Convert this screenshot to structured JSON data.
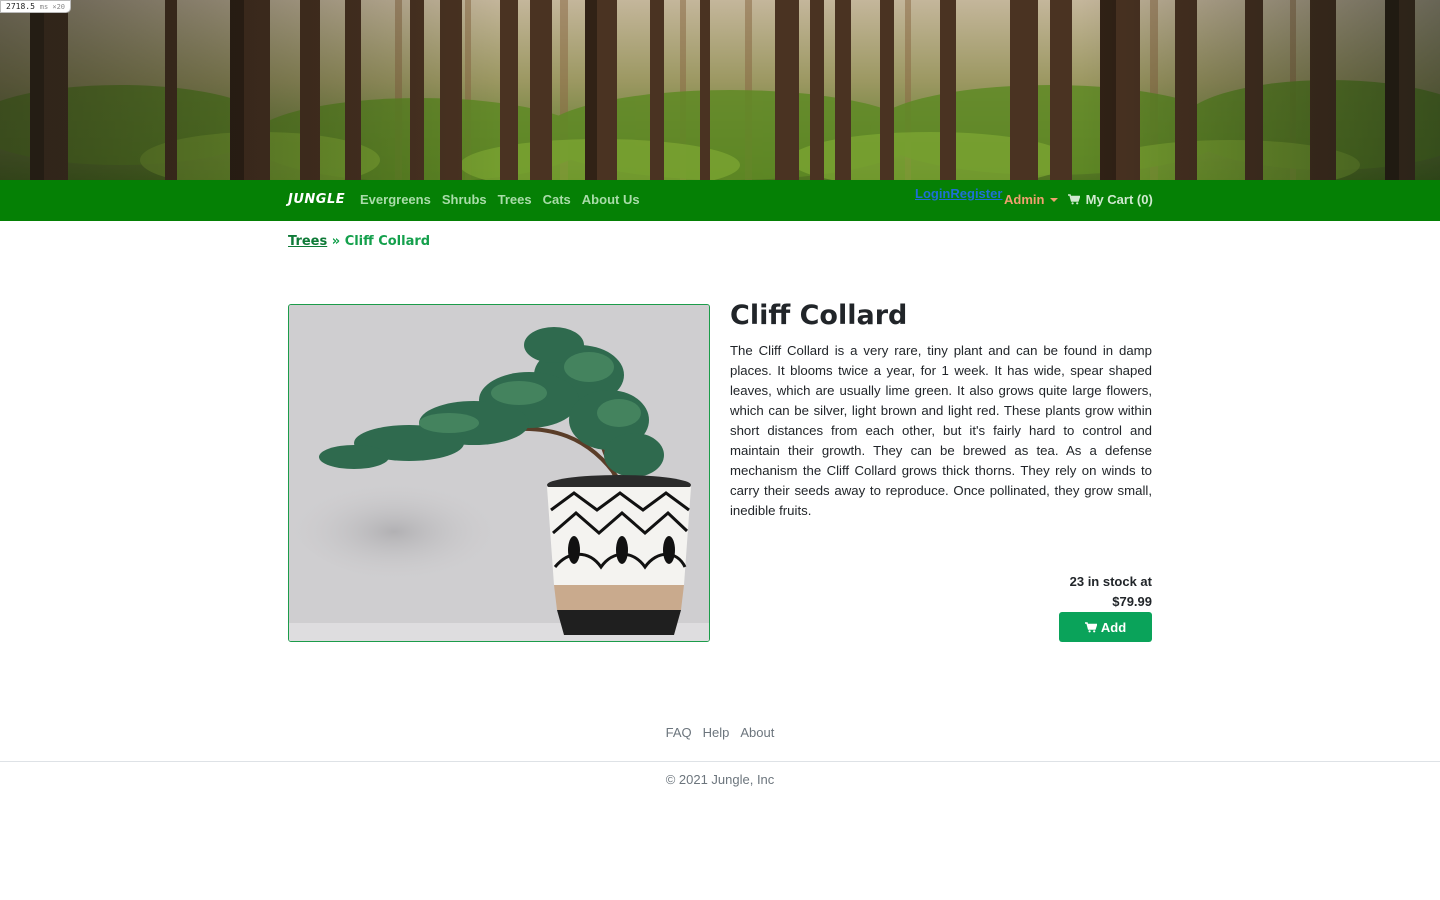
{
  "debug": {
    "readout": "2718.5",
    "suffix": "ms ×20"
  },
  "nav": {
    "brand": "JUNGLE",
    "links": [
      "Evergreens",
      "Shrubs",
      "Trees",
      "Cats",
      "About Us"
    ],
    "login": "Login",
    "register": "Register",
    "admin": "Admin",
    "cart": "My Cart (0)",
    "cart_icon": "cart-icon"
  },
  "breadcrumb": {
    "parent": "Trees",
    "separator": " » ",
    "current": "Cliff Collard"
  },
  "product": {
    "name": "Cliff Collard",
    "description": "The Cliff Collard is a very rare, tiny plant and can be found in damp places. It blooms twice a year, for 1 week. It has wide, spear shaped leaves, which are usually lime green. It also grows quite large flowers, which can be silver, light brown and light red. These plants grow within short distances from each other, but it's fairly hard to control and maintain their growth. They can be brewed as tea. As a defense mechanism the Cliff Collard grows thick thorns. They rely on winds to carry their seeds away to reproduce. Once pollinated, they grow small, inedible fruits.",
    "stock_line": "23 in stock at",
    "price": "$79.99",
    "add_label": "Add"
  },
  "footer": {
    "links": [
      "FAQ",
      "Help",
      "About"
    ],
    "copyright": "© 2021 Jungle, Inc"
  },
  "colors": {
    "nav_bg": "#058005",
    "accent_green": "#0aa35a",
    "admin_orange": "#f0a070",
    "auth_blue": "#1e6fd6"
  }
}
